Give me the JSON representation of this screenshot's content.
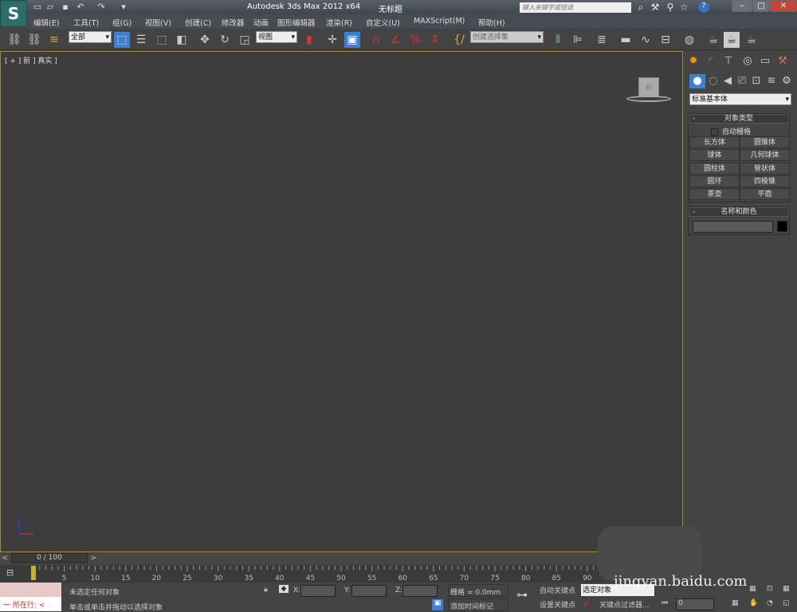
{
  "titlebar": {
    "title": "Autodesk 3ds Max  2012 x64",
    "document": "无标题",
    "search_placeholder": "键入关键字或短语"
  },
  "menu": [
    "编辑(E)",
    "工具(T)",
    "组(G)",
    "视图(V)",
    "创建(C)",
    "修改器",
    "动画",
    "图形编辑器",
    "渲染(R)",
    "自定义(U)",
    "MAXScript(M)",
    "帮助(H)"
  ],
  "toolbar": {
    "selection_filter": "全部",
    "reference_coord": "视图",
    "named_selection": "创建选择集"
  },
  "viewport": {
    "label": "[ + ] 前 ] 真实 ]",
    "viewcube_face": "前"
  },
  "command_panel": {
    "category": "标准基本体",
    "object_type_title": "对象类型",
    "autogrid_label": "自动栅格",
    "autogrid_checked": false,
    "objects": [
      "长方体",
      "圆锥体",
      "球体",
      "几何球体",
      "圆柱体",
      "管状体",
      "圆环",
      "四棱锥",
      "茶壶",
      "平面"
    ],
    "name_color_title": "名称和颜色",
    "object_color": "#000000"
  },
  "timeline": {
    "frame_display": "0 / 100",
    "current_frame": 0,
    "ticks": [
      "0",
      "5",
      "10",
      "15",
      "20",
      "25",
      "30",
      "35",
      "40",
      "45",
      "50",
      "55",
      "60",
      "65",
      "70",
      "75",
      "80",
      "85",
      "90"
    ]
  },
  "status": {
    "selection": "未选定任何对象",
    "prompt": "单击或单击并拖动以选择对象",
    "x_label": "X:",
    "y_label": "Y:",
    "z_label": "Z:",
    "grid": "栅格 = 0.0mm",
    "add_time_tag": "添加时间标记",
    "auto_key": "自动关键点",
    "set_key": "设置关键点",
    "key_mode": "选定对象",
    "key_filters": "关键点过滤器...",
    "frame_value": "0",
    "maxscript_line": "一  所在行:  <"
  },
  "watermark": "jingyan.baidu.com",
  "colors": {
    "viewport_border": "#a08a3a",
    "active_button": "#3e7fd0",
    "viewport_bg": "#3d3d3d"
  }
}
